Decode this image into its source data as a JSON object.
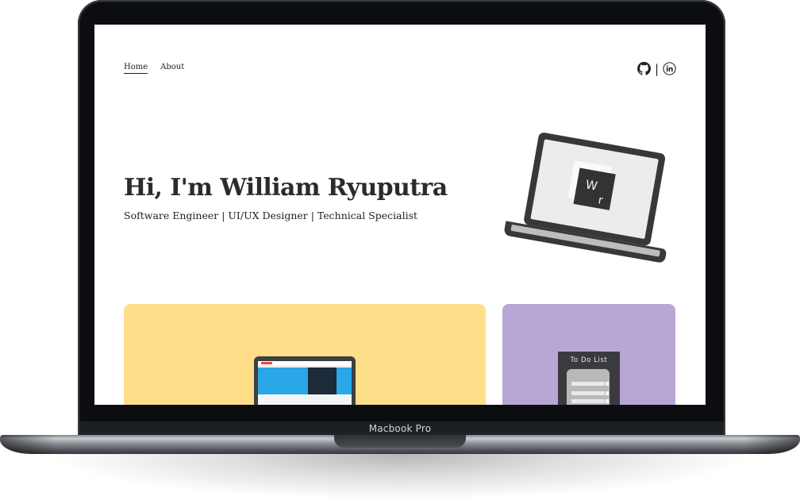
{
  "device": {
    "label": "Macbook Pro"
  },
  "site": {
    "nav": {
      "home_label": "Home",
      "about_label": "About"
    },
    "social": {
      "icons": [
        "github-icon",
        "linkedin-icon"
      ],
      "separator": "|"
    },
    "hero": {
      "title": "Hi, I'm William Ryuputra",
      "subtitle": "Software Engineer | UI/UX Designer | Technical Specialist",
      "logo_text": "wr"
    },
    "projects": {
      "cards": [
        {
          "id": "project-web",
          "background": "#ffde8a"
        },
        {
          "id": "project-todo",
          "background": "#b8a6d4",
          "preview_title": "To Do List"
        }
      ]
    }
  },
  "colors": {
    "text": "#2b2b2b",
    "device_bezel": "#0b0d10",
    "card_yellow": "#ffde8a",
    "card_purple": "#b8a6d4"
  }
}
